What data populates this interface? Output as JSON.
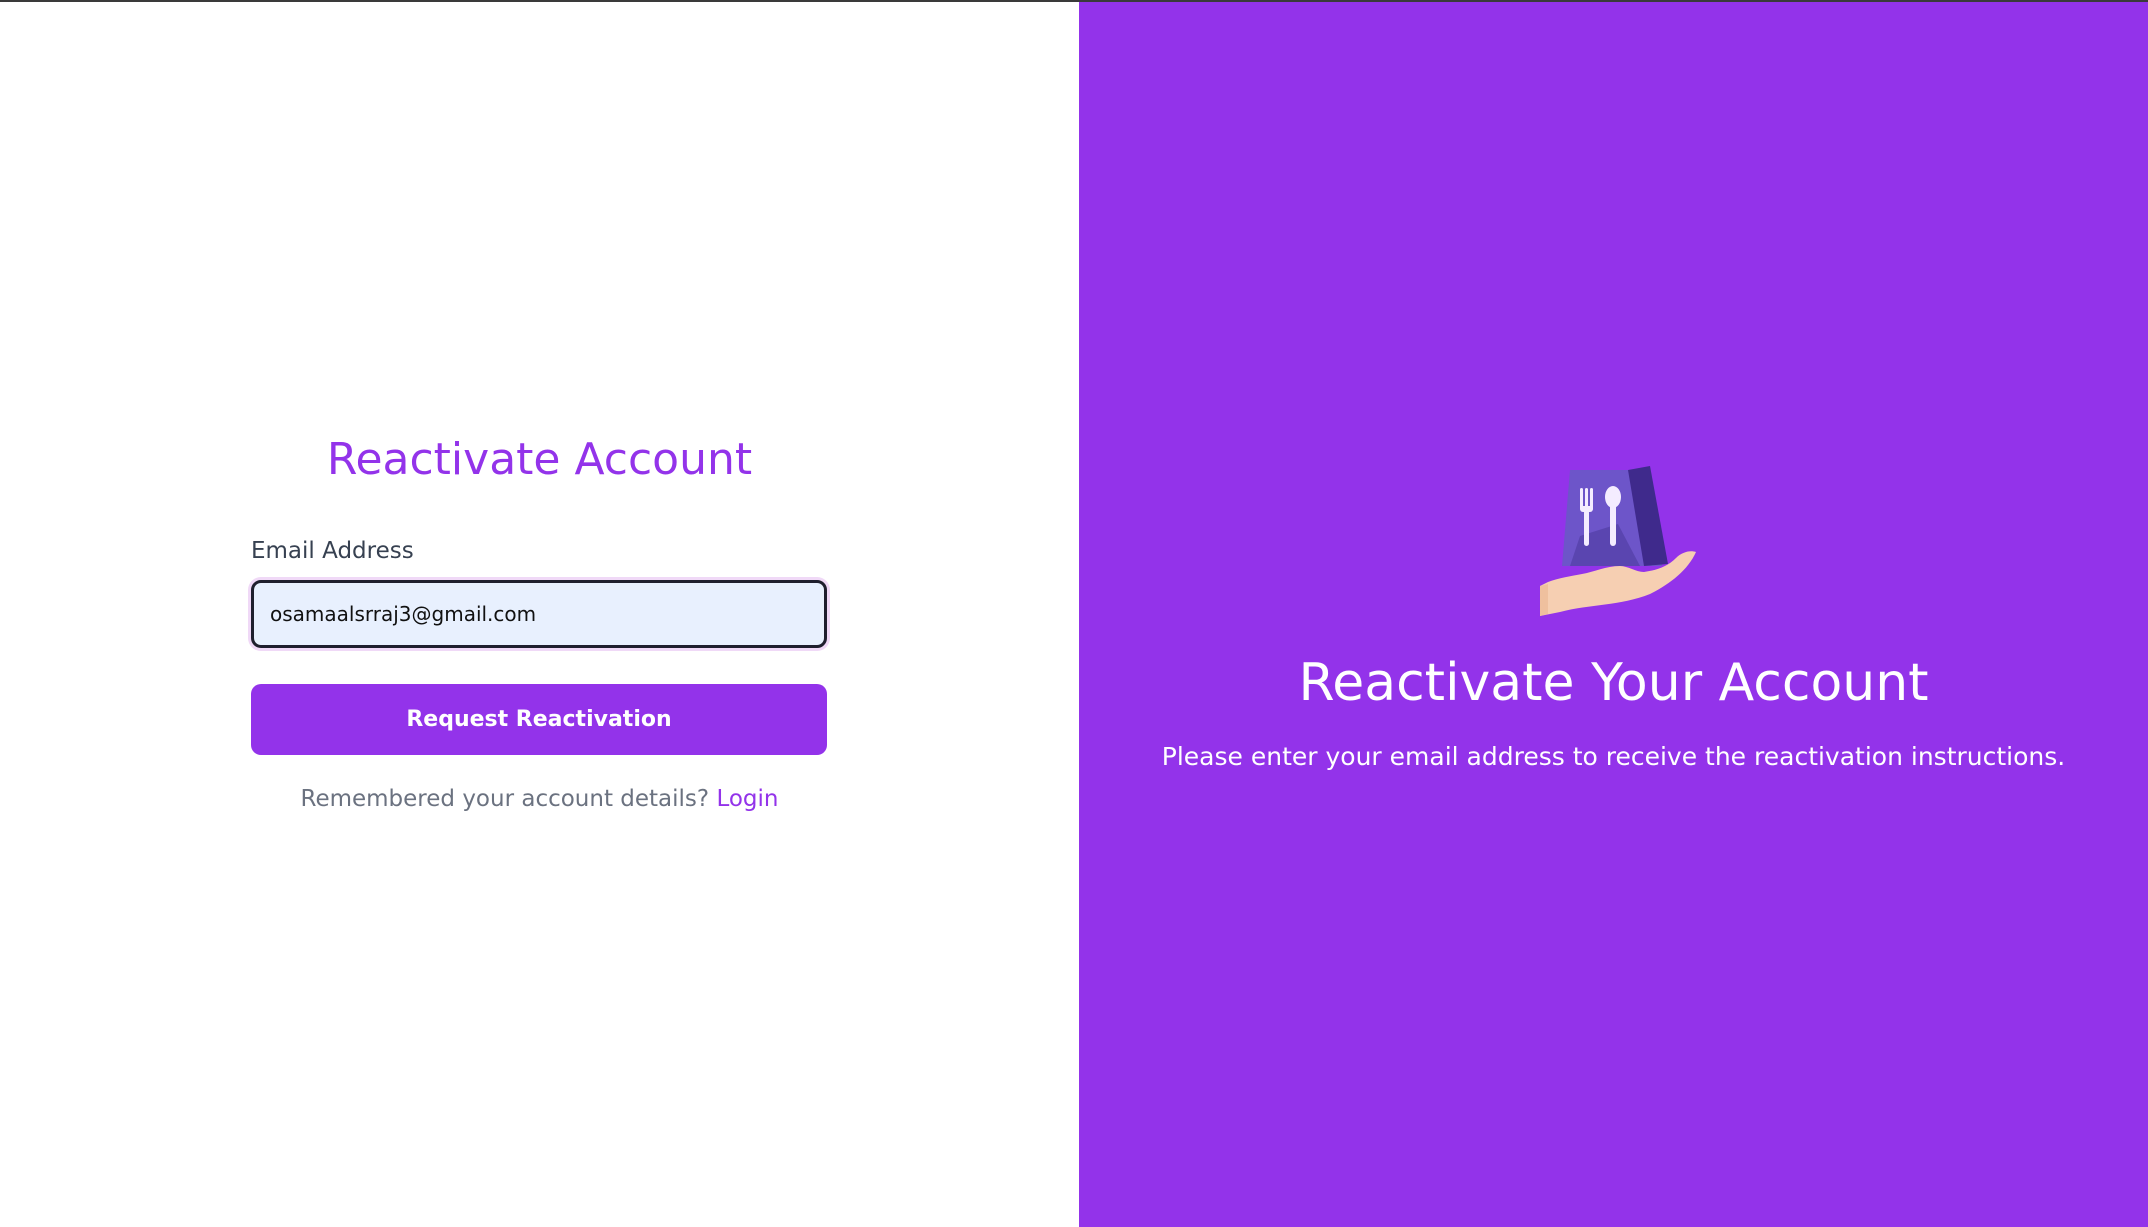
{
  "form": {
    "title": "Reactivate Account",
    "email_label": "Email Address",
    "email_value": "osamaalsrraj3@gmail.com",
    "submit_label": "Request Reactivation",
    "login_prompt": "Remembered your account details?",
    "login_link": "Login"
  },
  "promo": {
    "icon": "food-delivery-bag-hand-icon",
    "title": "Reactivate Your Account",
    "subtitle": "Please enter your email address to receive the reactivation instructions."
  },
  "colors": {
    "brand_purple": "#9333ea",
    "input_background": "#e8f0fe",
    "text_gray": "#6b7280",
    "label_dark": "#374151"
  }
}
